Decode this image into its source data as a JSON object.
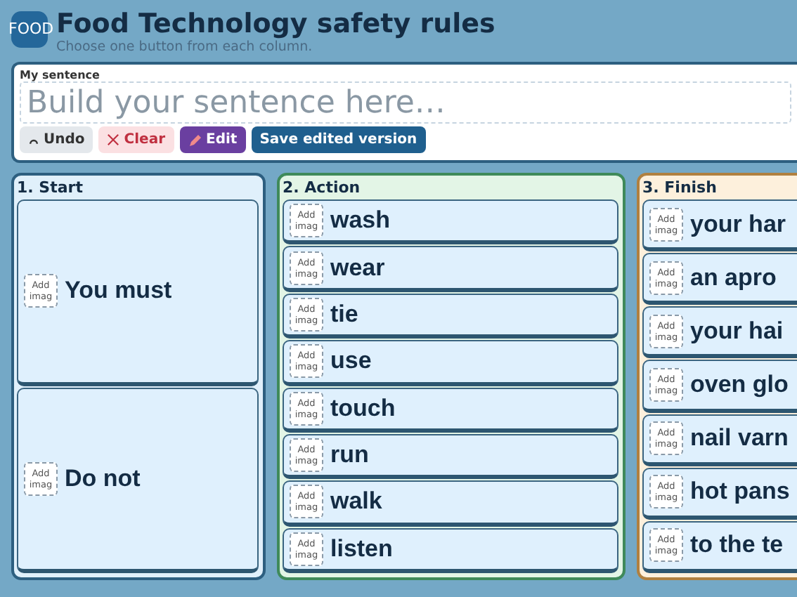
{
  "header": {
    "icon_text": "FOOD",
    "title": "Food Technology safety rules",
    "subtitle": "Choose one button from each column."
  },
  "sentence": {
    "label": "My sentence",
    "placeholder": "Build your sentence here…"
  },
  "buttons": [
    {
      "kind": "undo",
      "label": "Undo"
    },
    {
      "kind": "clear",
      "label": "Clear"
    },
    {
      "kind": "edit",
      "label": "Edit"
    },
    {
      "kind": "save",
      "label": "Save edited version"
    }
  ],
  "columns": [
    {
      "heading": "1. Start",
      "color": "#e0f0fb",
      "items": [
        {
          "text": "You must",
          "image": "Add imag"
        },
        {
          "text": "Do not",
          "image": "Add imag"
        }
      ]
    },
    {
      "heading": "2. Action",
      "color": "#e3f5e6",
      "items": [
        {
          "text": "wash",
          "image": "Add imag"
        },
        {
          "text": "wear",
          "image": "Add imag"
        },
        {
          "text": "tie",
          "image": "Add imag"
        },
        {
          "text": "use",
          "image": "Add imag"
        },
        {
          "text": "touch",
          "image": "Add imag"
        },
        {
          "text": "run",
          "image": "Add imag"
        },
        {
          "text": "walk",
          "image": "Add imag"
        },
        {
          "text": "listen",
          "image": "Add imag"
        }
      ]
    },
    {
      "heading": "3. Finish",
      "color": "#fdf0dc",
      "items": [
        {
          "text": "your har",
          "image": "Add imag"
        },
        {
          "text": "an apro",
          "image": "Add imag"
        },
        {
          "text": "your hai",
          "image": "Add imag"
        },
        {
          "text": "oven glo",
          "image": "Add imag"
        },
        {
          "text": "nail varn",
          "image": "Add imag"
        },
        {
          "text": "hot pans",
          "image": "Add imag"
        },
        {
          "text": "to the te",
          "image": "Add imag"
        }
      ]
    }
  ]
}
